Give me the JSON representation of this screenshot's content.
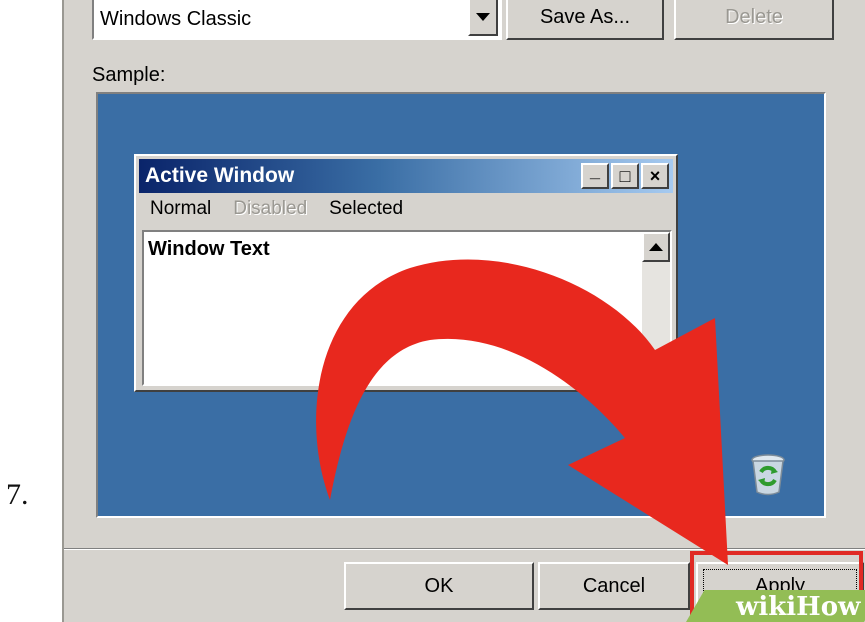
{
  "step": {
    "number": "7."
  },
  "scheme": {
    "selected": "Windows Classic"
  },
  "buttons": {
    "save_as": "Save As...",
    "delete": "Delete",
    "ok": "OK",
    "cancel": "Cancel",
    "apply": "Apply"
  },
  "sample": {
    "label": "Sample:",
    "window_title": "Active Window",
    "caption": {
      "minimize": "_",
      "maximize": "□",
      "close": "×"
    },
    "menu": {
      "normal": "Normal",
      "disabled": "Disabled",
      "selected": "Selected"
    },
    "window_text": "Window Text"
  },
  "watermark": {
    "text": "wikiHow"
  },
  "colors": {
    "desktop": "#3a6ea5",
    "face": "#d6d3ce",
    "highlight_box": "#e02a24",
    "arrow": "#e8281e",
    "watermark_bg": "#93bd55"
  },
  "icons": {
    "recycle_bin": "recycle-bin-icon",
    "dropdown": "dropdown-arrow-icon"
  }
}
